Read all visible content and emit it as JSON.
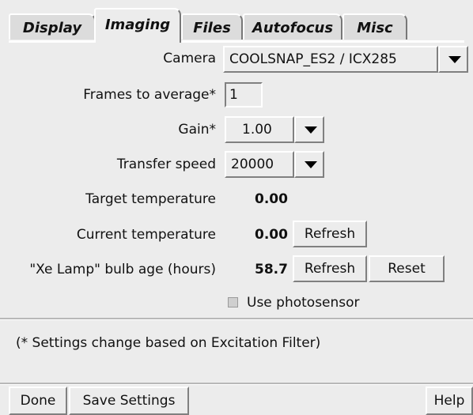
{
  "tabs": [
    {
      "label": "Display"
    },
    {
      "label": "Imaging"
    },
    {
      "label": "Files"
    },
    {
      "label": "Autofocus"
    },
    {
      "label": "Misc"
    }
  ],
  "active_tab": "Imaging",
  "camera": {
    "label": "Camera",
    "value": "COOLSNAP_ES2 / ICX285"
  },
  "frames": {
    "label": "Frames to average*",
    "value": "1"
  },
  "gain": {
    "label": "Gain*",
    "value": "1.00"
  },
  "transfer": {
    "label": "Transfer speed",
    "value": "20000"
  },
  "target_temp": {
    "label": "Target temperature",
    "value": "0.00"
  },
  "current_temp": {
    "label": "Current temperature",
    "value": "0.00",
    "refresh": "Refresh"
  },
  "bulb": {
    "label": "\"Xe Lamp\" bulb age (hours)",
    "value": "58.7",
    "refresh": "Refresh",
    "reset": "Reset"
  },
  "photosensor": {
    "label": "Use photosensor",
    "checked": false
  },
  "note": "(* Settings change based on Excitation Filter)",
  "footer": {
    "done": "Done",
    "save": "Save Settings",
    "help": "Help"
  }
}
